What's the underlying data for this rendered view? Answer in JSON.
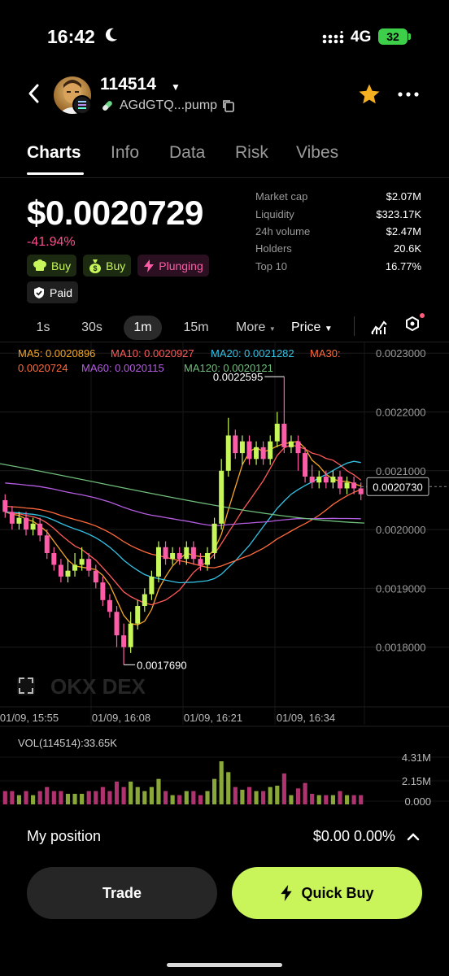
{
  "status_bar": {
    "time": "16:42",
    "network": "4G",
    "battery": "32"
  },
  "header": {
    "token_name": "114514",
    "address": "AGdGTQ...pump"
  },
  "tabs": [
    {
      "label": "Charts",
      "active": true
    },
    {
      "label": "Info"
    },
    {
      "label": "Data"
    },
    {
      "label": "Risk"
    },
    {
      "label": "Vibes"
    }
  ],
  "price": {
    "value": "$0.0020729",
    "change": "-41.94%"
  },
  "tags": [
    {
      "label": "Buy",
      "icon": "chef-hat-icon",
      "style": "green"
    },
    {
      "label": "Buy",
      "icon": "money-bag-icon",
      "style": "green"
    },
    {
      "label": "Plunging",
      "icon": "lightning-icon",
      "style": "pink"
    },
    {
      "label": "Paid",
      "icon": "shield-icon",
      "style": "grey"
    }
  ],
  "stats": [
    {
      "label": "Market cap",
      "value": "$2.07M"
    },
    {
      "label": "Liquidity",
      "value": "$323.17K"
    },
    {
      "label": "24h volume",
      "value": "$2.47M"
    },
    {
      "label": "Holders",
      "value": "20.6K"
    },
    {
      "label": "Top 10",
      "value": "16.77%"
    }
  ],
  "timeframes": [
    {
      "label": "1s"
    },
    {
      "label": "30s"
    },
    {
      "label": "1m",
      "active": true
    },
    {
      "label": "15m"
    },
    {
      "label": "More"
    }
  ],
  "price_mode": "Price",
  "ma_legend": {
    "ma5": "MA5: 0.0020896",
    "ma10": "MA10: 0.0020927",
    "ma20": "MA20: 0.0021282",
    "ma30_a": "MA30:",
    "ma30_b": "0.0020724",
    "ma60": "MA60: 0.0020115",
    "ma120": "MA120: 0.0020121"
  },
  "colors": {
    "up": "#c6f65a",
    "down": "#ff5ca8",
    "ma5": "#f5a623",
    "ma10": "#ff5a5a",
    "ma20": "#33c3e6",
    "ma30": "#ff6a3d",
    "ma60": "#b45de0",
    "ma120": "#6fbf7a"
  },
  "chart_data": {
    "type": "candlestick",
    "y_ticks": [
      "0.0023000",
      "0.0022000",
      "0.0021000",
      "0.0020000",
      "0.0019000",
      "0.0018000"
    ],
    "x_ticks": [
      "01/09, 15:55",
      "01/09, 16:08",
      "01/09, 16:21",
      "01/09, 16:34"
    ],
    "ylim": [
      0.00174,
      0.00231
    ],
    "high_label": "0.0022595",
    "low_label": "0.0017690",
    "last_price_label": "0.0020730",
    "last_price": 0.002073,
    "candles": [
      [
        0.00205,
        0.00203,
        0.00206,
        0.00202
      ],
      [
        0.00203,
        0.00201,
        0.00204,
        0.002
      ],
      [
        0.00201,
        0.00202,
        0.00203,
        0.002
      ],
      [
        0.00202,
        0.002,
        0.00203,
        0.00199
      ],
      [
        0.002,
        0.00201,
        0.00202,
        0.00199
      ],
      [
        0.00201,
        0.00199,
        0.00202,
        0.00198
      ],
      [
        0.00199,
        0.00196,
        0.002,
        0.00195
      ],
      [
        0.00196,
        0.00194,
        0.00197,
        0.00193
      ],
      [
        0.00194,
        0.00192,
        0.00195,
        0.00191
      ],
      [
        0.00192,
        0.00193,
        0.00195,
        0.00191
      ],
      [
        0.00193,
        0.00194,
        0.00196,
        0.00192
      ],
      [
        0.00194,
        0.00195,
        0.00197,
        0.00193
      ],
      [
        0.00195,
        0.00193,
        0.00196,
        0.00192
      ],
      [
        0.00193,
        0.00191,
        0.00194,
        0.0019
      ],
      [
        0.00191,
        0.00188,
        0.00192,
        0.00187
      ],
      [
        0.00188,
        0.00186,
        0.00189,
        0.00185
      ],
      [
        0.00186,
        0.00182,
        0.00187,
        0.0018
      ],
      [
        0.00182,
        0.0018,
        0.00184,
        0.00177
      ],
      [
        0.0018,
        0.00184,
        0.00186,
        0.00179
      ],
      [
        0.00184,
        0.00187,
        0.00188,
        0.00183
      ],
      [
        0.00187,
        0.00189,
        0.0019,
        0.00186
      ],
      [
        0.00189,
        0.00192,
        0.00193,
        0.00188
      ],
      [
        0.00192,
        0.00197,
        0.00198,
        0.00191
      ],
      [
        0.00197,
        0.00195,
        0.00198,
        0.00194
      ],
      [
        0.00195,
        0.00196,
        0.00197,
        0.00194
      ],
      [
        0.00196,
        0.00195,
        0.00197,
        0.00194
      ],
      [
        0.00195,
        0.00197,
        0.00198,
        0.00194
      ],
      [
        0.00197,
        0.00195,
        0.00198,
        0.00194
      ],
      [
        0.00195,
        0.00194,
        0.00196,
        0.00193
      ],
      [
        0.00194,
        0.00196,
        0.00197,
        0.00193
      ],
      [
        0.00196,
        0.00201,
        0.00202,
        0.00195
      ],
      [
        0.00201,
        0.0021,
        0.00212,
        0.002
      ],
      [
        0.0021,
        0.00216,
        0.00219,
        0.00209
      ],
      [
        0.00216,
        0.00213,
        0.00217,
        0.00212
      ],
      [
        0.00213,
        0.00215,
        0.00216,
        0.00211
      ],
      [
        0.00215,
        0.00212,
        0.00216,
        0.00211
      ],
      [
        0.00212,
        0.00214,
        0.00215,
        0.00211
      ],
      [
        0.00214,
        0.00212,
        0.00215,
        0.00211
      ],
      [
        0.00212,
        0.00215,
        0.00216,
        0.00211
      ],
      [
        0.00215,
        0.00218,
        0.0022,
        0.00214
      ],
      [
        0.00218,
        0.00214,
        0.00226,
        0.00213
      ],
      [
        0.00214,
        0.00215,
        0.00216,
        0.00213
      ],
      [
        0.00215,
        0.00213,
        0.00216,
        0.0021
      ],
      [
        0.00213,
        0.00209,
        0.00214,
        0.00208
      ],
      [
        0.00209,
        0.00208,
        0.00211,
        0.00207
      ],
      [
        0.00208,
        0.00209,
        0.0021,
        0.00207
      ],
      [
        0.00209,
        0.00208,
        0.0021,
        0.00207
      ],
      [
        0.00208,
        0.00209,
        0.0021,
        0.00207
      ],
      [
        0.00209,
        0.00207,
        0.0021,
        0.00206
      ],
      [
        0.00207,
        0.00208,
        0.00209,
        0.00206
      ],
      [
        0.00208,
        0.00207,
        0.00209,
        0.00206
      ],
      [
        0.00207,
        0.00206,
        0.00208,
        0.00205
      ]
    ],
    "volume_ticks": [
      "4.31M",
      "2.15M",
      "0.000"
    ],
    "volume_label": "VOL(114514):33.65K"
  },
  "position": {
    "label": "My position",
    "value": "$0.00 0.00%"
  },
  "actions": {
    "trade": "Trade",
    "quick_buy": "Quick Buy"
  }
}
